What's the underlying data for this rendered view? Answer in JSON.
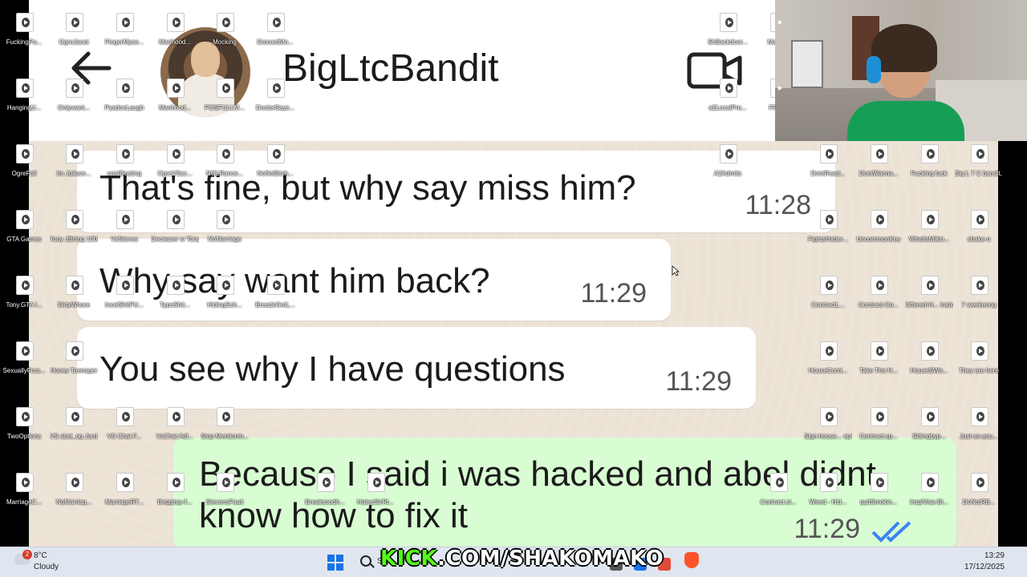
{
  "chat": {
    "contact_name": "BigLtcBandit",
    "messages": [
      {
        "text": "That's fine, but why say miss him?",
        "time": "11:28",
        "direction": "incoming"
      },
      {
        "text": "Why say want him back?",
        "time": "11:29",
        "direction": "incoming"
      },
      {
        "text": "You see why I have questions",
        "time": "11:29",
        "direction": "incoming"
      },
      {
        "text": "Because I said i was hacked and abel didnt know how to fix it",
        "time": "11:29",
        "direction": "outgoing",
        "status": "read"
      }
    ],
    "colors": {
      "outgoing_bubble": "#d9fdd3",
      "incoming_bubble": "#ffffff",
      "read_ticks": "#3b82f6"
    }
  },
  "desktop_icons": [
    "FuckingPu...",
    "OgreJacet",
    "FingerMyse...",
    "Manhood...",
    "Mocking",
    "DoxxedMo...",
    "ShBackdoor...",
    "Manh...",
    "HangingU...",
    "Onlywant...",
    "PysdoeLaugh",
    "Manhood...",
    "POSFULLM...",
    "DoctorSays...",
    "a2LocalPre...",
    "FRD...",
    "OgreFull",
    "Im Juliuce...",
    "cantBeating",
    "OgreVSsc...",
    "NOLRance...",
    "NoNoBitch...",
    "A2Admits",
    "DontRead...",
    "DontWanna...",
    "Fucking fuck",
    "Big L T C bandit, h...",
    "GTA Games",
    "Tony JBrling 100subs",
    "VsSteves",
    "Deceaser w TonyGTA",
    "NoMarriage",
    "FightsHatter...",
    "UncommonKey",
    "WhatIsMikin...",
    "shake-o",
    "Tony.GTA I...",
    "DirtyWhore",
    "IncelShitFU...",
    "TypeShit...",
    "HidingSch...",
    "BreadcGetL...",
    "ContractL...",
    "Contract-Co...",
    "Offered-H... Instead",
    "7 weekeong",
    "SexuallyFrus...",
    "Honey Teenager",
    "HouseComi...",
    "Take The H...",
    "HouseSWo...",
    "They are here",
    "TwoOptions",
    "VS abel_og Jord-Wizent",
    "VS Chat F...",
    "VsChat Adi...",
    "Stop Mentionin...",
    "Sign-house... ep4994",
    "Contract.sp...",
    "Sittingbyp...",
    "Just-so-you...",
    "MarriageC...",
    "NoMarriag...",
    "MarriageRT...",
    "Begging-4...",
    "StevensFault",
    "Breaksoodh...",
    "HatesStrRt...",
    "Contract.si...",
    "Weed - Hid...",
    "quitSmokin...",
    "Iraq/Visa-Bi...",
    "DoNotRB..."
  ],
  "taskbar": {
    "weather_badge": "2",
    "weather_temp": "8°C",
    "weather_condition": "Cloudy",
    "search_text": "S",
    "clock_time": "13:29",
    "clock_date": "17/12/2025"
  },
  "stream_overlay": {
    "kick_prefix": "KICK",
    "kick_rest": ".COM/SHAKOMAKO"
  }
}
